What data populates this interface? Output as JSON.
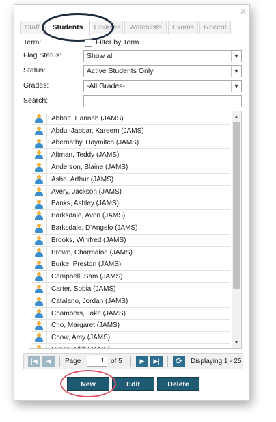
{
  "window": {
    "close_glyph": "✕"
  },
  "tabs": [
    {
      "label": "Staff",
      "active": false
    },
    {
      "label": "Students",
      "active": true
    },
    {
      "label": "Courses",
      "active": false
    },
    {
      "label": "Watchlists",
      "active": false
    },
    {
      "label": "Exams",
      "active": false
    },
    {
      "label": "Recent",
      "active": false
    }
  ],
  "filters": {
    "term_label": "Term:",
    "filter_by_term_label": "Filter by Term",
    "filter_by_term_checked": false,
    "flag_status_label": "Flag Status:",
    "flag_status_value": "Show all",
    "status_label": "Status:",
    "status_value": "Active Students Only",
    "grades_label": "Grades:",
    "grades_value": "-All Grades-",
    "search_label": "Search:",
    "search_value": ""
  },
  "students": [
    "Abbott, Hannah (JAMS)",
    "Abdul-Jabbar, Kareem (JAMS)",
    "Abernathy, Haymitch (JAMS)",
    "Altman, Teddy (JAMS)",
    "Anderson, Blaine (JAMS)",
    "Ashe, Arthur (JAMS)",
    "Avery, Jackson (JAMS)",
    "Banks, Ashley (JAMS)",
    "Barksdale, Avon (JAMS)",
    "Barksdale, D'Angelo (JAMS)",
    "Brooks, Winifred (JAMS)",
    "Brown, Charmaine (JAMS)",
    "Burke, Preston (JAMS)",
    "Campbell, Sam (JAMS)",
    "Carter, Sobia (JAMS)",
    "Catalano, Jordan (JAMS)",
    "Chambers, Jake (JAMS)",
    "Cho, Margaret (JAMS)",
    "Chow, Amy (JAMS)",
    "Clavin, Cliff (JAMS)"
  ],
  "pager": {
    "first_glyph": "|◀",
    "prev_glyph": "◀",
    "page_label": "Page",
    "page_value": "1",
    "of_label": "of 5",
    "next_glyph": "▶",
    "last_glyph": "▶|",
    "refresh_glyph": "⟳",
    "displaying": "Displaying 1 - 25"
  },
  "actions": {
    "new": "New",
    "edit": "Edit",
    "delete": "Delete"
  },
  "colors": {
    "primary_button": "#1f5a73",
    "pager_button": "#2c6e8c",
    "callout_new": "#d9536c",
    "callout_tab": "#1d2b3d"
  }
}
